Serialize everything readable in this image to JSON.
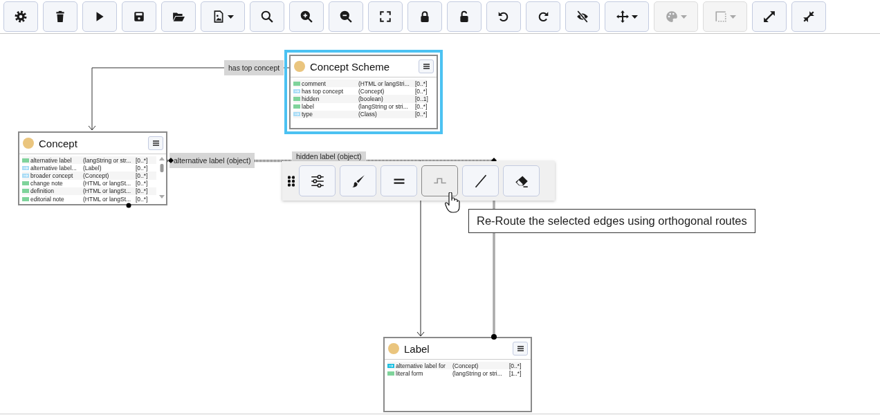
{
  "toolbar": [
    {
      "kind": "settings",
      "dropdown": false,
      "disabled": false
    },
    {
      "kind": "delete",
      "dropdown": false,
      "disabled": false
    },
    {
      "kind": "run",
      "dropdown": false,
      "disabled": false
    },
    {
      "kind": "save",
      "dropdown": false,
      "disabled": false
    },
    {
      "kind": "open",
      "dropdown": false,
      "disabled": false
    },
    {
      "kind": "export-image",
      "dropdown": true,
      "disabled": false
    },
    {
      "kind": "search",
      "dropdown": false,
      "disabled": false
    },
    {
      "kind": "zoom-in",
      "dropdown": false,
      "disabled": false
    },
    {
      "kind": "zoom-out",
      "dropdown": false,
      "disabled": false
    },
    {
      "kind": "fit",
      "dropdown": false,
      "disabled": false
    },
    {
      "kind": "lock",
      "dropdown": false,
      "disabled": false
    },
    {
      "kind": "unlock",
      "dropdown": false,
      "disabled": false
    },
    {
      "kind": "undo",
      "dropdown": false,
      "disabled": false
    },
    {
      "kind": "redo",
      "dropdown": false,
      "disabled": false
    },
    {
      "kind": "hide",
      "dropdown": false,
      "disabled": false
    },
    {
      "kind": "move",
      "dropdown": true,
      "disabled": false
    },
    {
      "kind": "palette",
      "dropdown": true,
      "disabled": true
    },
    {
      "kind": "selection",
      "dropdown": true,
      "disabled": true
    },
    {
      "kind": "expand",
      "dropdown": false,
      "disabled": false
    },
    {
      "kind": "collapse",
      "dropdown": false,
      "disabled": false
    }
  ],
  "nodes": [
    {
      "title": "Concept Scheme",
      "selected": true,
      "rows": [
        {
          "kind": "literal",
          "name": "comment",
          "type": "(HTML or langStri...",
          "cardinality": "[0..*]"
        },
        {
          "kind": "object",
          "name": "has top concept",
          "type": "(Concept)",
          "cardinality": "[0..*]"
        },
        {
          "kind": "literal",
          "name": "hidden",
          "type": "(boolean)",
          "cardinality": "[0..1]"
        },
        {
          "kind": "literal",
          "name": "label",
          "type": "(langString or stri...",
          "cardinality": "[0..*]"
        },
        {
          "kind": "object",
          "name": "type",
          "type": "(Class)",
          "cardinality": "[0..*]"
        }
      ]
    },
    {
      "title": "Concept",
      "selected": false,
      "rows": [
        {
          "kind": "literal",
          "name": "alternative label",
          "type": "(langString or str...",
          "cardinality": "[0..*]"
        },
        {
          "kind": "object",
          "name": "alternative label...",
          "type": "(Label)",
          "cardinality": "[0..*]"
        },
        {
          "kind": "object",
          "name": "broader concept",
          "type": "(Concept)",
          "cardinality": "[0..*]"
        },
        {
          "kind": "literal",
          "name": "change note",
          "type": "(HTML or langSt...",
          "cardinality": "[0..*]"
        },
        {
          "kind": "literal",
          "name": "definition",
          "type": "(HTML or langSt...",
          "cardinality": "[0..*]"
        },
        {
          "kind": "literal",
          "name": "editorial note",
          "type": "(HTML or langSt...",
          "cardinality": "[0..*]"
        }
      ]
    },
    {
      "title": "Label",
      "selected": false,
      "rows": [
        {
          "kind": "object",
          "name": "alternative label for",
          "type": "(Concept)",
          "cardinality": "[0..*]",
          "highlighted": true
        },
        {
          "kind": "literal",
          "name": "literal form",
          "type": "(langString or stri...",
          "cardinality": "[1..*]",
          "highlighted": false
        }
      ]
    }
  ],
  "edge_labels": [
    "has top concept",
    "alternative label (object)",
    "hidden label (object)"
  ],
  "edge_toolbar": [
    {
      "kind": "properties",
      "selected": false
    },
    {
      "kind": "style",
      "selected": false
    },
    {
      "kind": "equal",
      "selected": false
    },
    {
      "kind": "orthogonal",
      "selected": true
    },
    {
      "kind": "straight",
      "selected": false
    },
    {
      "kind": "erase",
      "selected": false
    }
  ],
  "tooltip": "Re-Route the selected edges using orthogonal routes"
}
